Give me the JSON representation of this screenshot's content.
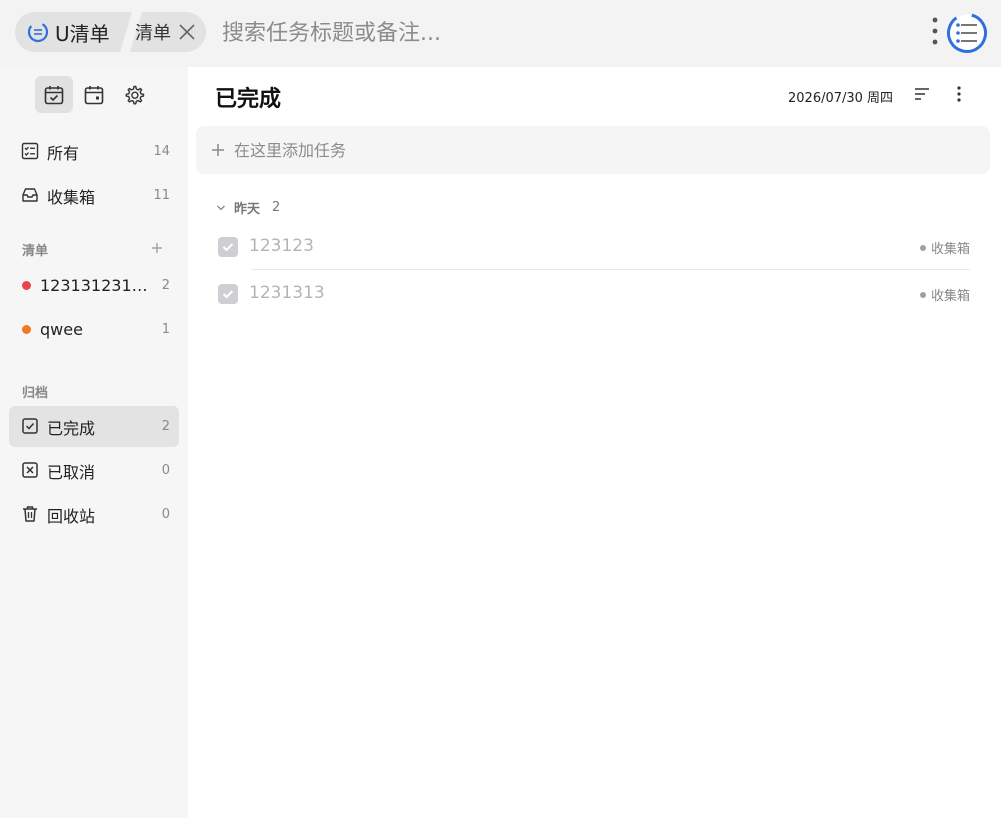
{
  "topbar": {
    "app_name": "U清单",
    "tab_label": "清单",
    "search_placeholder": "搜索任务标题或备注..."
  },
  "sidebar": {
    "tools": [
      {
        "icon": "calendar-check-icon",
        "active": true
      },
      {
        "icon": "calendar-icon",
        "active": false
      },
      {
        "icon": "gear-icon",
        "active": false
      }
    ],
    "main_items": [
      {
        "label": "所有",
        "count": "14",
        "icon": "list-checklist-icon"
      },
      {
        "label": "收集箱",
        "count": "11",
        "icon": "inbox-icon"
      }
    ],
    "lists_title": "清单",
    "lists": [
      {
        "label": "1231312314...",
        "count": "2",
        "color": "#e8454b"
      },
      {
        "label": "qwee",
        "count": "1",
        "color": "#f07a22"
      }
    ],
    "archive_title": "归档",
    "archive_items": [
      {
        "label": "已完成",
        "count": "2",
        "icon": "checkbox-icon",
        "active": true
      },
      {
        "label": "已取消",
        "count": "0",
        "icon": "cancel-box-icon",
        "active": false
      },
      {
        "label": "回收站",
        "count": "0",
        "icon": "trash-icon",
        "active": false
      }
    ]
  },
  "main": {
    "title": "已完成",
    "date": "2026/07/30 周四",
    "add_placeholder": "在这里添加任务",
    "group": {
      "name": "昨天",
      "count": "2"
    },
    "tasks": [
      {
        "title": "123123",
        "tag": "收集箱",
        "done": true
      },
      {
        "title": "1231313",
        "tag": "收集箱",
        "done": true
      }
    ]
  },
  "colors": {
    "accent": "#2f6fde",
    "topbar_bg": "#f3f3f3",
    "sidebar_bg": "#f6f6f6"
  }
}
